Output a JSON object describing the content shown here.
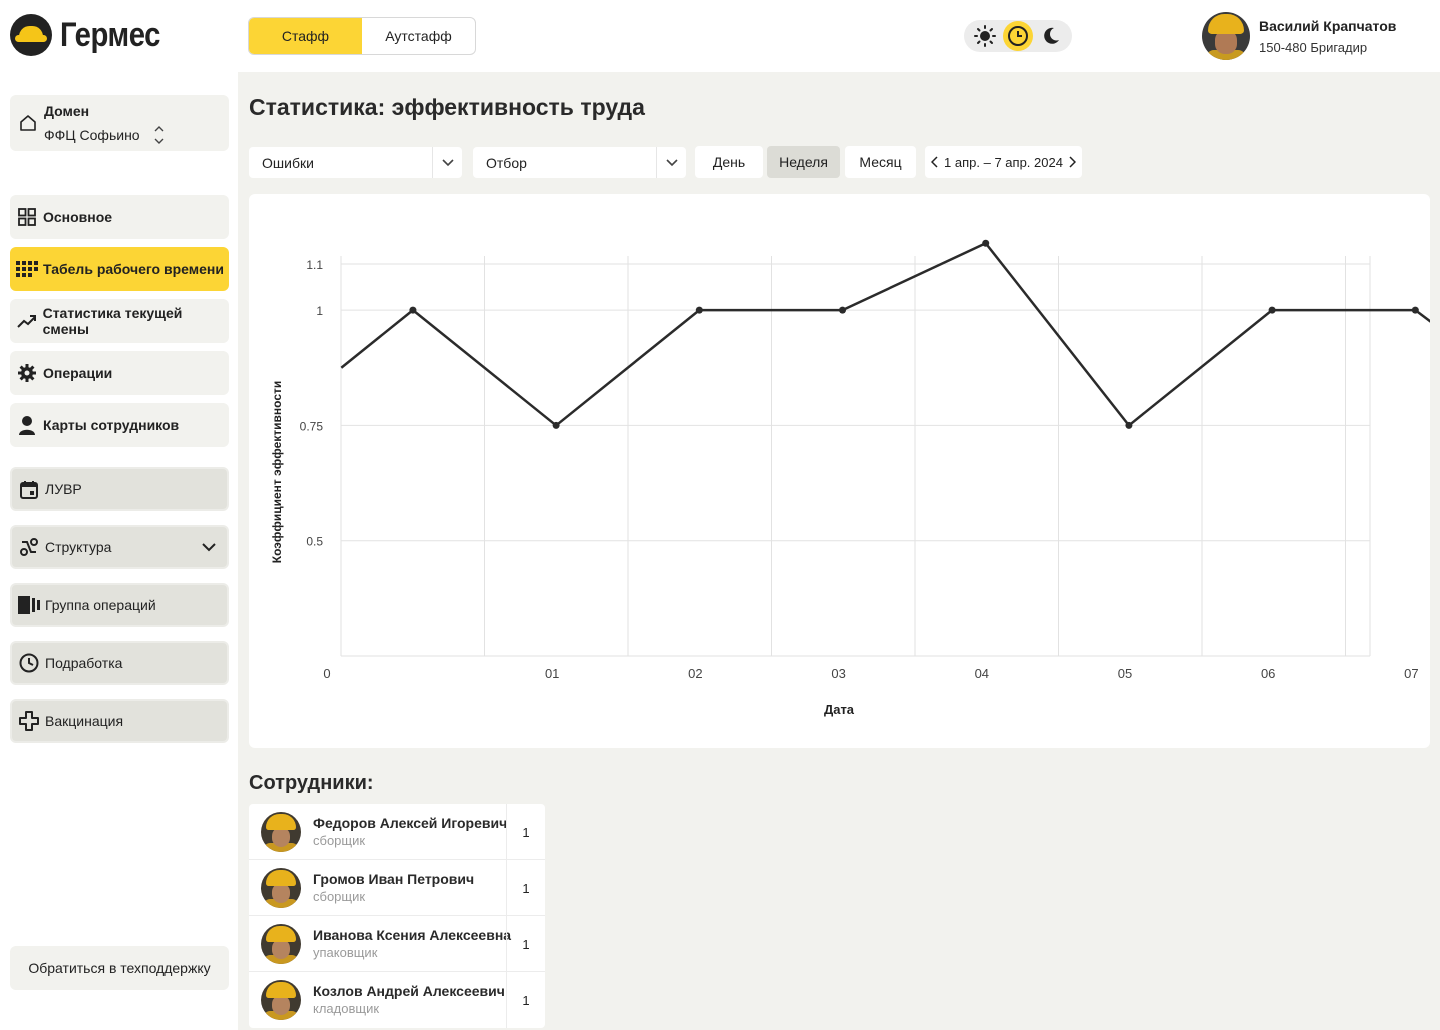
{
  "header": {
    "logo_text": "Гермес",
    "tabs": [
      {
        "label": "Стафф",
        "active": true
      },
      {
        "label": "Аутстафф",
        "active": false
      }
    ],
    "theme_modes": [
      "sun-icon",
      "clock-icon",
      "moon-icon"
    ],
    "theme_active": "clock-icon",
    "user": {
      "name": "Василий Крапчатов",
      "role": "150-480 Бригадир"
    }
  },
  "sidebar": {
    "domain": {
      "label": "Домен",
      "value": "ФФЦ Софьино"
    },
    "items": [
      {
        "label": "Основное",
        "icon": "grid-icon",
        "active": false
      },
      {
        "label": "Табель рабочего времени",
        "icon": "dots-grid-icon",
        "active": true
      },
      {
        "label": "Статистика текущей смены",
        "icon": "trend-icon",
        "active": false
      },
      {
        "label": "Операции",
        "icon": "gear-icon",
        "active": false
      },
      {
        "label": "Карты сотрудников",
        "icon": "person-icon",
        "active": false
      },
      {
        "label": "ЛУВР",
        "icon": "calendar-icon",
        "active": false
      },
      {
        "label": "Структура",
        "icon": "link-icon",
        "active": false
      },
      {
        "label": "Группа операций",
        "icon": "stack-icon",
        "active": false
      },
      {
        "label": "Подработка",
        "icon": "clock-icon",
        "active": false
      },
      {
        "label": "Вакцинация",
        "icon": "cross-icon",
        "active": false
      }
    ],
    "support_label": "Обратиться в техподдержку"
  },
  "main": {
    "title": "Статистика: эффективность труда",
    "filters": {
      "metric": "Ошибки",
      "selection": "Отбор",
      "periods": [
        "День",
        "Неделя",
        "Месяц"
      ],
      "selected_period": "Неделя",
      "date_range": "1 апр. – 7 апр. 2024"
    },
    "employees_title": "Сотрудники:",
    "employees": [
      {
        "name": "Федоров Алексей Игоревич",
        "role": "сборщик",
        "count": "1"
      },
      {
        "name": "Громов Иван Петрович",
        "role": "сборщик",
        "count": "1"
      },
      {
        "name": "Иванова Ксения Алексеевна",
        "role": "упаковщик",
        "count": "1"
      },
      {
        "name": "Козлов Андрей Алексеевич",
        "role": "кладовщик",
        "count": "1"
      }
    ]
  },
  "chart_data": {
    "type": "line",
    "xlabel": "Дата",
    "ylabel": "Коэффициент эффективности",
    "x_ticks": [
      "0",
      "01",
      "02",
      "03",
      "04",
      "05",
      "06",
      "07"
    ],
    "y_ticks": [
      "0.5",
      "0.75",
      "1",
      "1.1"
    ],
    "x": [
      0,
      1,
      2,
      3,
      4,
      5,
      6,
      7,
      8
    ],
    "values": [
      0.875,
      1.0,
      0.75,
      1.0,
      1.0,
      1.145,
      0.75,
      1.0,
      1.0,
      0.765
    ],
    "x_points": [
      0.1,
      0.6,
      1.6,
      2.6,
      3.6,
      4.6,
      5.6,
      6.6,
      7.6,
      8.6
    ],
    "marked_points": [
      1,
      2,
      3,
      4,
      5,
      6,
      7,
      8
    ],
    "ylim": [
      0.25,
      1.1
    ],
    "grid": true,
    "line_color": "#2b2b2b"
  }
}
